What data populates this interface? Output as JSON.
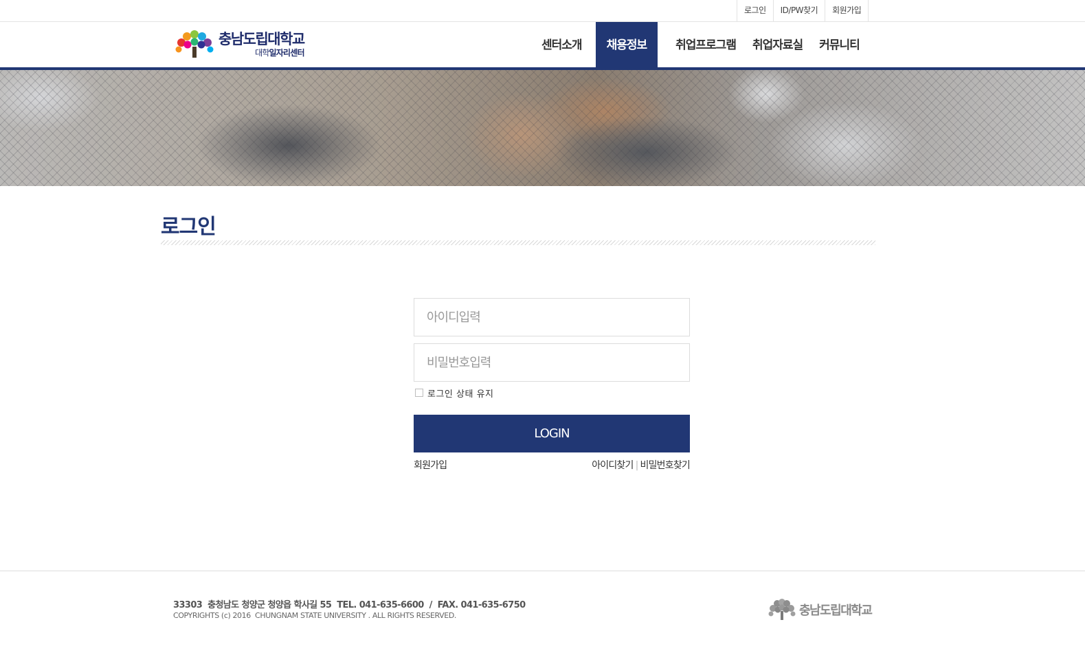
{
  "top_utility": {
    "login": "로그인",
    "find_id_pw": "ID/PW찾기",
    "signup": "회원가입"
  },
  "logo": {
    "main": "충남도립대학교",
    "sub_prefix": "대학",
    "sub_main": "일자리센터",
    "icon": "tree-logo-icon"
  },
  "nav": {
    "items": [
      {
        "label": "센터소개"
      },
      {
        "label": "채용정보",
        "active": true
      },
      {
        "label": "취업프로그램"
      },
      {
        "label": "취업자료실"
      },
      {
        "label": "커뮤니티"
      }
    ]
  },
  "page": {
    "title": "로그인"
  },
  "login_form": {
    "id_placeholder": "아이디입력",
    "pw_placeholder": "비밀번호입력",
    "keep_login": "로그인 상태 유지",
    "button": "LOGIN",
    "signup_link": "회원가입",
    "find_id_link": "아이디찾기",
    "separator": "|",
    "find_pw_link": "비밀번호찾기"
  },
  "footer": {
    "address": "33303  충청남도 청양군 청양읍 학사길 55  TEL. 041-635-6600  /  FAX. 041-635-6750",
    "copyright": "COPYRIGHTS (c) 2016  CHUNGNAM STATE UNIVERSITY . ALL RIGHTS RESERVED.",
    "logo_text": "충남도립대학교"
  },
  "colors": {
    "primary": "#213774",
    "border": "#dcdcdc"
  }
}
